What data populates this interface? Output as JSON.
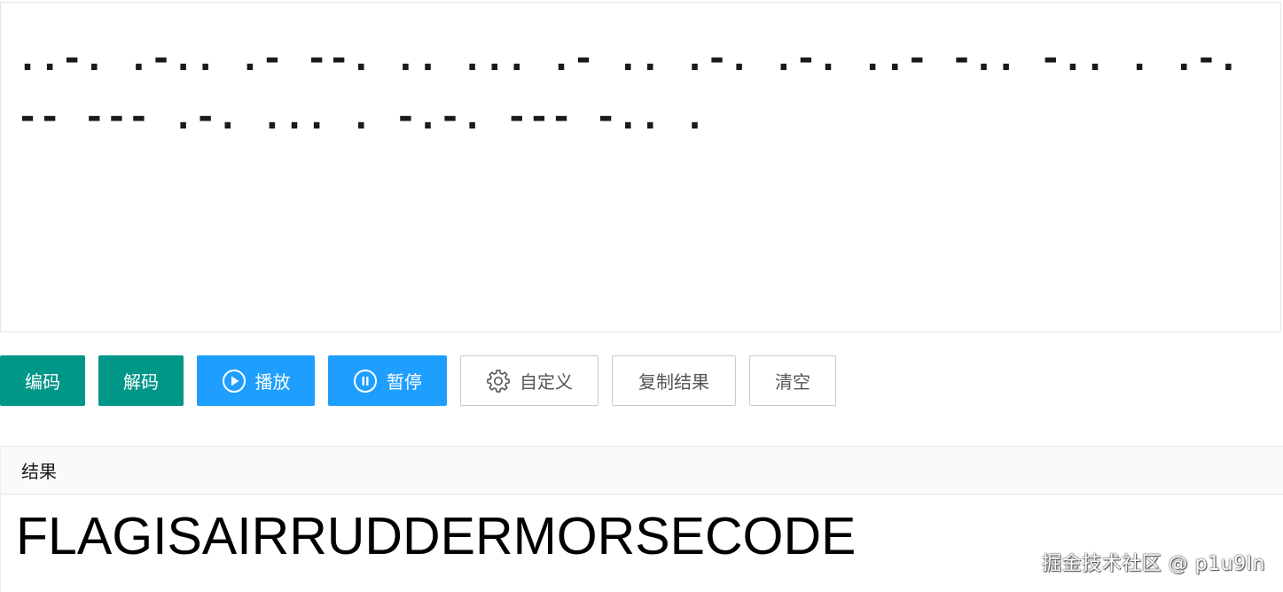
{
  "input": {
    "morse_text": "..-. .-.. .- --. .. ... .- .. .-. .-. ..- -.. -.. . .-. -- --- .-. ... . -.-. --- -.. ."
  },
  "toolbar": {
    "encode_label": "编码",
    "decode_label": "解码",
    "play_label": "播放",
    "pause_label": "暂停",
    "custom_label": "自定义",
    "copy_label": "复制结果",
    "clear_label": "清空"
  },
  "icons": {
    "play": "play-circle-icon",
    "pause": "pause-circle-icon",
    "custom": "gear-icon"
  },
  "colors": {
    "green": "#009688",
    "blue": "#1e9fff"
  },
  "result": {
    "header": "结果",
    "value": "FLAGISAIRRUDDERMORSECODE"
  },
  "watermark": {
    "text": "掘金技术社区 @ p1u9In"
  }
}
